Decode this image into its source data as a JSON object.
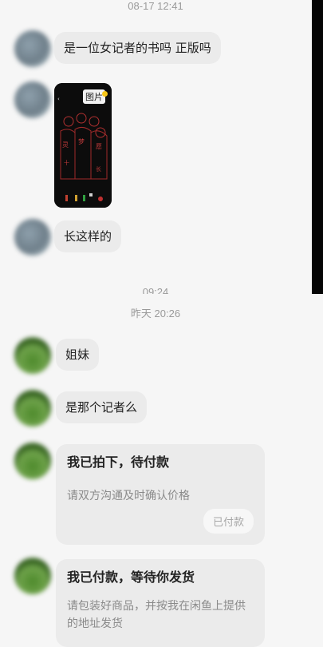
{
  "timestamps": [
    "08-17 12:41",
    "09:24",
    "昨天 20:26"
  ],
  "messages": [
    {
      "text": "是一位女记者的书吗 正版吗"
    },
    {
      "image_badge": "图片"
    },
    {
      "text": "长这样的"
    },
    {
      "text": "姐妹"
    },
    {
      "text": "是那个记者么"
    }
  ],
  "cards": [
    {
      "title": "我已拍下，待付款",
      "subtitle": "请双方沟通及时确认价格",
      "button": "已付款"
    },
    {
      "title": "我已付款，等待你发货",
      "subtitle": "请包装好商品，并按我在闲鱼上提供的地址发货"
    }
  ],
  "colors": {
    "bubble": "#ebebeb",
    "background": "#f6f6f6",
    "accent": "#f5c518"
  }
}
